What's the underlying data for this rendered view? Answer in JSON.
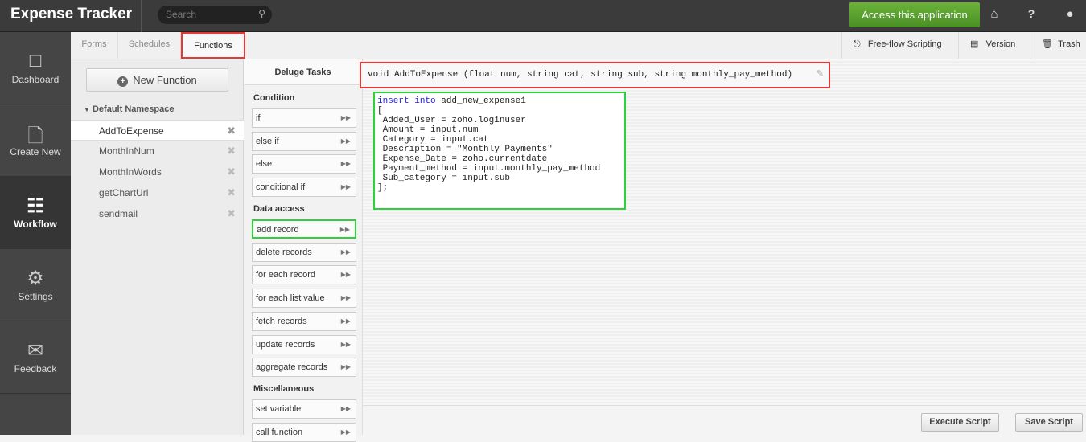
{
  "header": {
    "title": "Expense Tracker",
    "search_placeholder": "Search",
    "access_label": "Access this application",
    "icons": [
      "home-icon",
      "help-icon",
      "user-icon"
    ],
    "help_glyph": "?"
  },
  "nav": [
    {
      "label": "Dashboard",
      "icon": "monitor-icon"
    },
    {
      "label": "Create New",
      "icon": "new-file-icon"
    },
    {
      "label": "Workflow",
      "icon": "workflow-icon"
    },
    {
      "label": "Settings",
      "icon": "gear-icon"
    },
    {
      "label": "Feedback",
      "icon": "envelope-icon"
    }
  ],
  "subtabs": {
    "forms": "Forms",
    "schedules": "Schedules",
    "functions": "Functions",
    "freeflow": "Free-flow Scripting",
    "version": "Version",
    "trash": "Trash"
  },
  "functions": {
    "new_label": "New Function",
    "namespace": "Default Namespace",
    "items": [
      "AddToExpense",
      "MonthInNum",
      "MonthInWords",
      "getChartUrl",
      "sendmail"
    ]
  },
  "tasks": {
    "title": "Deluge Tasks",
    "categories": {
      "condition": "Condition",
      "data": "Data access",
      "misc": "Miscellaneous"
    },
    "condition": [
      "if",
      "else if",
      "else",
      "conditional if"
    ],
    "data": [
      "add record",
      "delete records",
      "for each record",
      "for each list value",
      "fetch records",
      "update records",
      "aggregate records"
    ],
    "misc": [
      "set variable",
      "call function"
    ]
  },
  "editor": {
    "signature": "void AddToExpense (float num, string cat, string sub, string monthly_pay_method)",
    "kw1": "insert",
    "kw2": "into",
    "table": " add_new_expense1",
    "body": "[\n Added_User = zoho.loginuser\n Amount = input.num\n Category = input.cat\n Description = \"Monthly Payments\"\n Expense_Date = zoho.currentdate\n Payment_method = input.monthly_pay_method\n Sub_category = input.sub\n];"
  },
  "footer": {
    "execute": "Execute Script",
    "save": "Save Script"
  },
  "colors": {
    "accent_green": "#4a8f24",
    "highlight_red": "#e53935",
    "highlight_green": "#2ed13a"
  }
}
